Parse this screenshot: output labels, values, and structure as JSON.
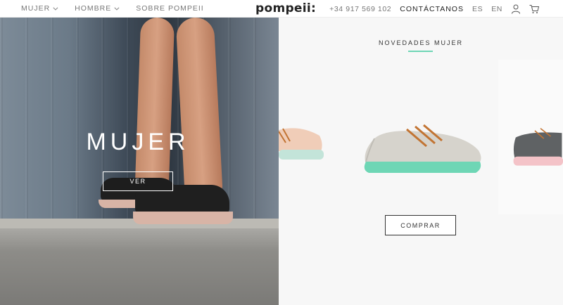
{
  "nav": {
    "left_items": [
      {
        "label": "MUJER",
        "has_dropdown": true
      },
      {
        "label": "HOMBRE",
        "has_dropdown": true
      },
      {
        "label": "SOBRE POMPEII",
        "has_dropdown": false
      }
    ],
    "logo": "pompeii:",
    "phone": "+34 917 569 102",
    "contact": "CONTÁCTANOS",
    "languages": [
      "ES",
      "EN"
    ],
    "icons": [
      "user-icon",
      "cart-icon"
    ]
  },
  "hero": {
    "title": "MUJER",
    "button_label": "VER"
  },
  "panel": {
    "title": "NOVEDADES MUJER",
    "accent_color": "#6ed6b5",
    "button_label": "COMPRAR"
  }
}
